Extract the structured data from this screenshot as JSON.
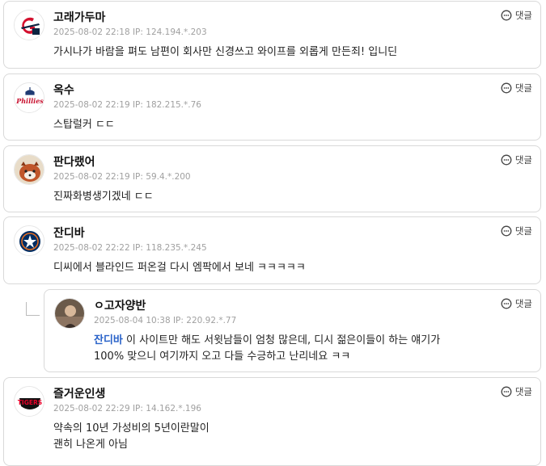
{
  "reply_label": "댓글",
  "comments": [
    {
      "nick": "고래가두마",
      "meta": "2025-08-02 22:18  IP: 124.194.*.203",
      "body": [
        "가시나가 바람을 펴도 남편이 회사만 신경쓰고 와이프를 외롭게 만든죄! 입니딘"
      ]
    },
    {
      "nick": "옥수",
      "meta": "2025-08-02 22:19  IP: 182.215.*.76",
      "body": [
        "스탑럴커 ㄷㄷ"
      ]
    },
    {
      "nick": "판다랬어",
      "meta": "2025-08-02 22:19  IP: 59.4.*.200",
      "body": [
        "진짜화병생기겠네 ㄷㄷ"
      ]
    },
    {
      "nick": "잔디바",
      "meta": "2025-08-02 22:22  IP: 118.235.*.245",
      "body": [
        "디씨에서 블라인드 퍼온걸 다시 엠팍에서 보네 ㅋㅋㅋㅋㅋ"
      ]
    },
    {
      "nick": "ㅇ고자양반",
      "meta": "2025-08-04 10:38  IP: 220.92.*.77",
      "mention": "잔디바",
      "body": [
        " 이 사이트만 해도 서윗남들이 엄청 많은데, 디시 젊은이들이 하는 얘기가",
        "100% 맞으니 여기까지 오고 다들 수긍하고 난리네요 ㅋㅋ"
      ]
    },
    {
      "nick": "즐거운인생",
      "meta": "2025-08-02 22:29  IP: 14.162.*.196",
      "body": [
        "약속의 10년 가성비의 5년이란말이",
        "괜히 나온게 아님"
      ]
    }
  ],
  "avatars": {
    "c0": {
      "name": "guardians-logo",
      "color": "#d3102e"
    },
    "c1": {
      "name": "phillies-logo",
      "color": "#c8102e"
    },
    "c2": {
      "name": "red-panda-photo",
      "color": "#c0562a"
    },
    "c3": {
      "name": "astros-logo",
      "color": "#002d62"
    },
    "c4": {
      "name": "user-photo",
      "color": "#6b5a4a"
    },
    "c5": {
      "name": "tigers-logo",
      "color": "#ea0029"
    }
  }
}
